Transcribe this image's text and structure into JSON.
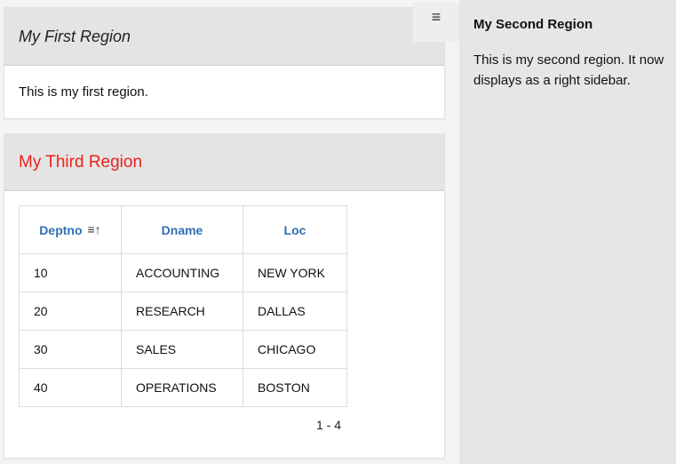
{
  "regions": {
    "first": {
      "title": "My First Region",
      "body": "This is my first region."
    },
    "second": {
      "title": "My Second Region",
      "body": "This is my second region. It now displays as a right sidebar."
    },
    "third": {
      "title": "My Third Region",
      "title_color": "#e8231a",
      "table": {
        "columns": [
          "Deptno",
          "Dname",
          "Loc"
        ],
        "sorted_column": "Deptno",
        "sort_icon": "sort-ascending-icon",
        "rows": [
          [
            "10",
            "ACCOUNTING",
            "NEW YORK"
          ],
          [
            "20",
            "RESEARCH",
            "DALLAS"
          ],
          [
            "30",
            "SALES",
            "CHICAGO"
          ],
          [
            "40",
            "OPERATIONS",
            "BOSTON"
          ]
        ]
      },
      "pagination": "1 - 4"
    }
  },
  "menu_toggle": {
    "icon": "hamburger-menu-icon"
  },
  "colors": {
    "link": "#2f6fb5",
    "sidebar_bg": "#e6e6e6",
    "main_bg": "#f4f4f4",
    "header_bg": "#e4e4e4"
  }
}
